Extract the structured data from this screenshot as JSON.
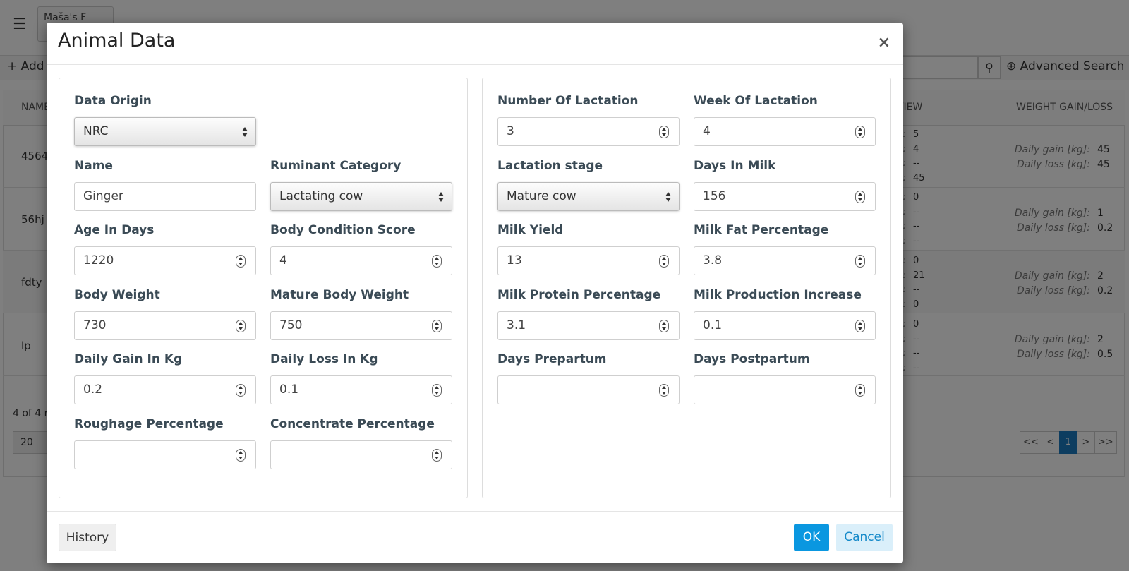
{
  "background": {
    "farm_name": "Maša's F",
    "add_label": "Add",
    "advanced_search_label": "Advanced Search",
    "columns": {
      "name": "NAME",
      "overview": "RVIEW",
      "weight": "WEIGHT GAIN/LOSS"
    },
    "rows": [
      {
        "name": "4564",
        "ov_keys": [
          "n:",
          "g]:",
          "g]:",
          "n:"
        ],
        "ov_vals": [
          "5",
          "4",
          "--",
          "45"
        ],
        "gain_label": "Daily gain [kg]:",
        "gain": "45",
        "loss_label": "Daily loss [kg]:",
        "loss": "45"
      },
      {
        "name": "56hj",
        "ov_keys": [
          "n:",
          "g]:",
          "g]:",
          "n:"
        ],
        "ov_vals": [
          "0",
          "--",
          "--",
          "--"
        ],
        "gain_label": "Daily gain [kg]:",
        "gain": "1",
        "loss_label": "Daily loss [kg]:",
        "loss": "0.2"
      },
      {
        "name": "fdty",
        "ov_keys": [
          "n:",
          "g]:",
          "g]:",
          "n:"
        ],
        "ov_vals": [
          "0",
          "21",
          "--",
          "0"
        ],
        "gain_label": "Daily gain [kg]:",
        "gain": "2",
        "loss_label": "Daily loss [kg]:",
        "loss": "0.2"
      },
      {
        "name": "lp",
        "ov_keys": [
          "n:",
          "g]:",
          "g]:",
          "n:"
        ],
        "ov_vals": [
          "0",
          "--",
          "--",
          "--"
        ],
        "gain_label": "Daily gain [kg]:",
        "gain": "2",
        "loss_label": "Daily loss [kg]:",
        "loss": "0.5"
      }
    ],
    "records_text": "4 of 4 r",
    "page_size": "20",
    "pager": [
      "<<",
      "<",
      "1",
      ">",
      ">>"
    ],
    "current_page": "1"
  },
  "modal": {
    "title": "Animal Data",
    "close_label": "×",
    "left": {
      "data_origin": {
        "label": "Data Origin",
        "value": "NRC"
      },
      "name": {
        "label": "Name",
        "value": "Ginger"
      },
      "ruminant_category": {
        "label": "Ruminant Category",
        "value": "Lactating cow"
      },
      "age_in_days": {
        "label": "Age In Days",
        "value": "1220"
      },
      "body_condition_score": {
        "label": "Body Condition Score",
        "value": "4"
      },
      "body_weight": {
        "label": "Body Weight",
        "value": "730"
      },
      "mature_body_weight": {
        "label": "Mature Body Weight",
        "value": "750"
      },
      "daily_gain": {
        "label": "Daily Gain In Kg",
        "value": "0.2"
      },
      "daily_loss": {
        "label": "Daily Loss In Kg",
        "value": "0.1"
      },
      "roughage": {
        "label": "Roughage Percentage",
        "value": ""
      },
      "concentrate": {
        "label": "Concentrate Percentage",
        "value": ""
      }
    },
    "right": {
      "number_of_lactation": {
        "label": "Number Of Lactation",
        "value": "3"
      },
      "week_of_lactation": {
        "label": "Week Of Lactation",
        "value": "4"
      },
      "lactation_stage": {
        "label": "Lactation stage",
        "value": "Mature cow"
      },
      "days_in_milk": {
        "label": "Days In Milk",
        "value": "156"
      },
      "milk_yield": {
        "label": "Milk Yield",
        "value": "13"
      },
      "milk_fat": {
        "label": "Milk Fat Percentage",
        "value": "3.8"
      },
      "milk_protein": {
        "label": "Milk Protein Percentage",
        "value": "3.1"
      },
      "milk_production_increase": {
        "label": "Milk Production Increase",
        "value": "0.1"
      },
      "days_prepartum": {
        "label": "Days Prepartum",
        "value": ""
      },
      "days_postpartum": {
        "label": "Days Postpartum",
        "value": ""
      }
    },
    "footer": {
      "history_label": "History",
      "ok_label": "OK",
      "cancel_label": "Cancel"
    },
    "colors": {
      "primary": "#0a97e0",
      "cancel_bg": "#daeffa",
      "label": "#3a4a55"
    }
  }
}
